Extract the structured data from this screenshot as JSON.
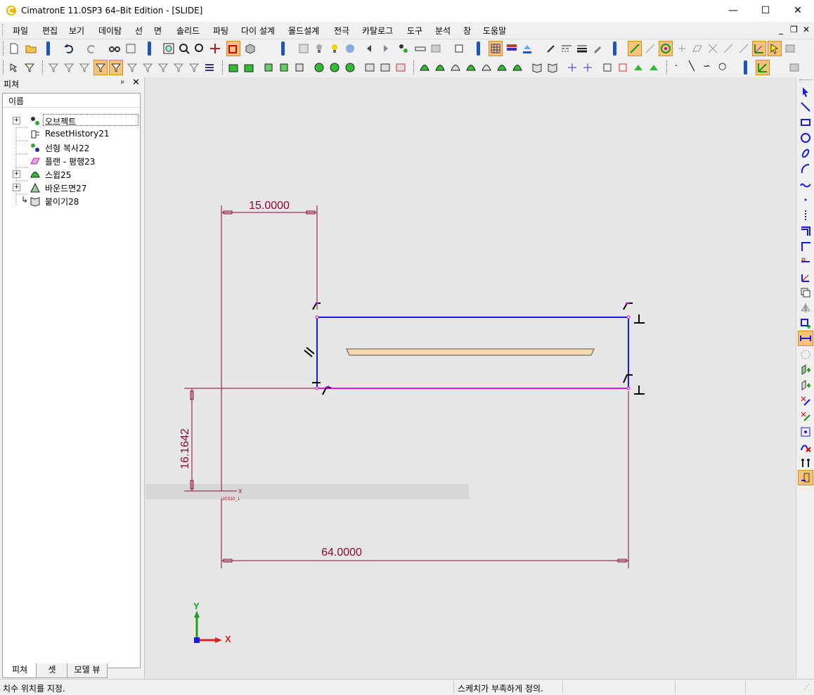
{
  "window": {
    "title": "CimatronE 11.0SP3 64–Bit Edition - [SLIDE]",
    "minimize": "—",
    "maximize": "☐",
    "close": "✕"
  },
  "menu": {
    "items": [
      "파일",
      "편집",
      "보기",
      "데이탐",
      "선",
      "면",
      "솔리드",
      "파팅",
      "다이 설계",
      "몰드설계",
      "전극",
      "카탈로그",
      "도구",
      "분석",
      "창",
      "도움말"
    ],
    "mdi_min": "_",
    "mdi_restore": "❐",
    "mdi_close": "✕"
  },
  "feature_panel": {
    "title": "피쳐",
    "pin": "ᵖ",
    "close": "✕",
    "column_header": "이름",
    "items": [
      {
        "label": "오브젝트",
        "icon": "objects-icon",
        "expandable": true,
        "selected": true
      },
      {
        "label": "ResetHistory21",
        "icon": "reset-history-icon",
        "expandable": false
      },
      {
        "label": "선형 복사22",
        "icon": "linear-copy-icon",
        "expandable": false
      },
      {
        "label": "플랜 - 평행23",
        "icon": "plane-parallel-icon",
        "expandable": false
      },
      {
        "label": "스윕25",
        "icon": "sweep-icon",
        "expandable": true
      },
      {
        "label": "바운드면27",
        "icon": "bound-face-icon",
        "expandable": true
      },
      {
        "label": "붙이기28",
        "icon": "attach-icon",
        "expandable": false,
        "current": true
      }
    ],
    "tabs": [
      "피쳐",
      "셋",
      "모델 뷰"
    ]
  },
  "sketch": {
    "dim_top": "15.0000",
    "dim_left": "16.1642",
    "dim_bottom": "64.0000",
    "ucs_label": "UCS10_1",
    "axis_x": "X",
    "axis_y": "Y",
    "colors": {
      "dimension": "#8b0a33",
      "profile_blue": "#1a1adb",
      "profile_magenta": "#e01ae0",
      "part_fill": "#f7d9b0",
      "axis_x": "#e02020",
      "axis_y": "#20a020",
      "axis_origin": "#1a1adb"
    }
  },
  "status": {
    "left": "치수 위치를 지정.",
    "middle": "스케치가 부족하게 정의."
  }
}
